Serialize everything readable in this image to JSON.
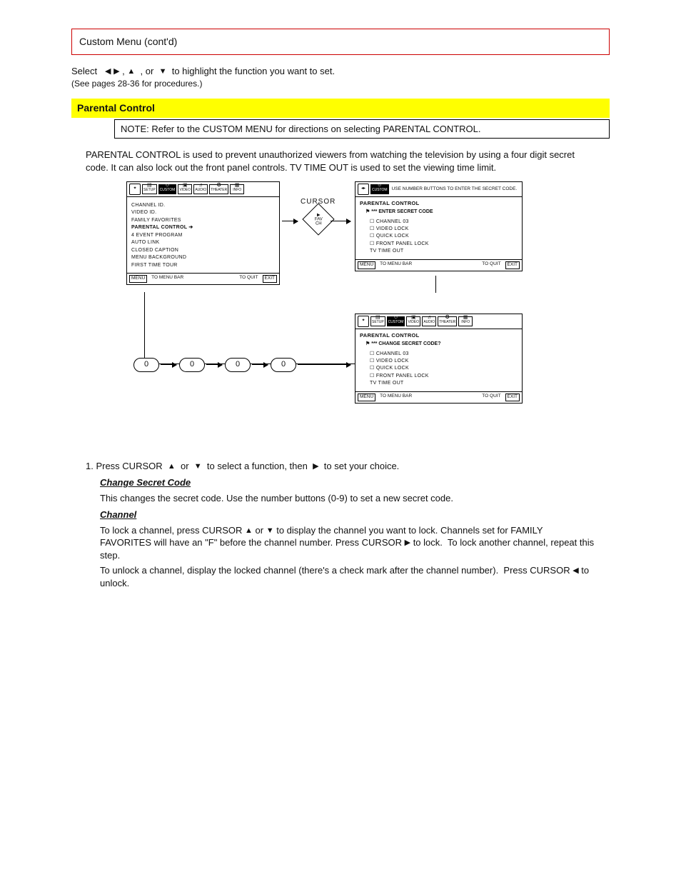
{
  "redbox": "Custom Menu (cont'd)",
  "lead": {
    "prefix": "Select",
    "arrows_note": ",     , or      to highlight the function you want to set.",
    "suffix_small": "(See pages 28-36 for procedures.)"
  },
  "yellow": "Parental Control",
  "note": "NOTE: Refer to the CUSTOM MENU for directions on selecting PARENTAL CONTROL.",
  "intro": "PARENTAL CONTROL is used to prevent unauthorized viewers from watching the television by using a four digit secret code. It can also lock out the front panel controls. TV TIME OUT is used to set the viewing time limit.",
  "osd": {
    "tabs": [
      "SETUP",
      "CUSTOM",
      "VIDEO",
      "AUDIO",
      "THEATER",
      "INFO"
    ],
    "menu1": {
      "items": [
        "CHANNEL ID.",
        "VIDEO ID.",
        "FAMILY FAVORITES",
        "PARENTAL CONTROL",
        "4 EVENT PROGRAM",
        "AUTO LINK",
        "CLOSED CAPTION",
        "MENU BACKGROUND",
        "FIRST TIME TOUR"
      ],
      "selected_index": 3
    },
    "menu2": {
      "banner": "USE NUMBER BUTTONS TO ENTER THE SECRET CODE.",
      "title": "PARENTAL CONTROL",
      "prompt": "*** ENTER SECRET CODE",
      "items": [
        "CHANNEL 03",
        "VIDEO LOCK",
        "QUICK LOCK",
        "FRONT PANEL LOCK",
        "TV TIME OUT"
      ]
    },
    "menu3": {
      "title": "PARENTAL CONTROL",
      "prompt": "*** CHANGE SECRET CODE?",
      "items": [
        "CHANNEL 03",
        "VIDEO LOCK",
        "QUICK LOCK",
        "FRONT PANEL LOCK",
        "TV TIME OUT"
      ]
    },
    "foot": {
      "a": "MENU",
      "b": "TO MENU BAR",
      "c": "TO QUIT",
      "d": "EXIT"
    },
    "cursor_label": "CURSOR",
    "cursor_inner_top": "▶",
    "cursor_inner_mid": "FAV",
    "cursor_inner_bot": "CH",
    "zero": "0"
  },
  "steps": {
    "s1": {
      "text_a": "1.  Press CURSOR",
      "text_b": "or",
      "text_c": "to select a function, then",
      "text_d": "to set your choice."
    },
    "entries": [
      {
        "name": "Change Secret  Code",
        "body": "This changes the secret code. Use the number buttons (0-9) to set a new secret code."
      },
      {
        "name": "Channel",
        "body_a": "To lock a channel, press CURSOR     or     to display the channel you want to lock. Channels set for FAMILY FAVORITES will have an \"F\" before the channel number. Press CURSOR    to lock.  To lock another channel, repeat this step.",
        "body_b": "To unlock a channel, display the locked channel (there's a check mark after the channel number).  Press CURSOR     to unlock."
      }
    ]
  }
}
